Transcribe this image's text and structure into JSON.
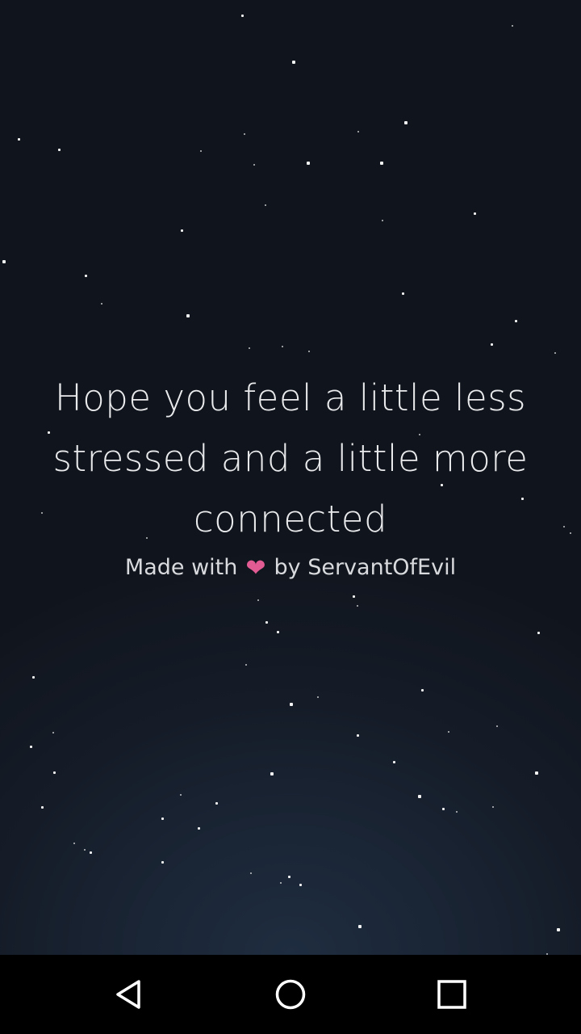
{
  "main": {
    "quote": "Hope you feel a little less stressed and a little more connected",
    "credit_prefix": "Made with",
    "heart_icon": "❤",
    "credit_suffix": "by ServantOfEvil"
  },
  "navbar": {
    "back_icon": "back-triangle-icon",
    "home_icon": "home-circle-icon",
    "recents_icon": "recents-square-icon"
  },
  "colors": {
    "background_top": "#10141c",
    "background_glow": "#1f2d40",
    "text": "#e9eaec",
    "heart": "#e35b93",
    "navbar": "#000000"
  }
}
